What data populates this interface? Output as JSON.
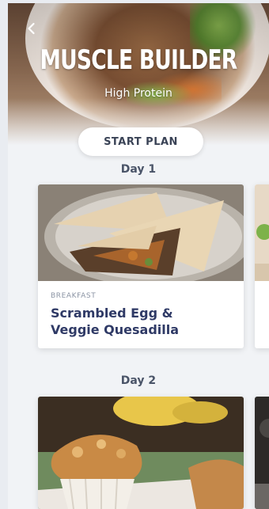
{
  "header": {
    "title": "MUSCLE BUILDER",
    "subtitle": "High Protein",
    "start_button_label": "START PLAN",
    "back_icon": "chevron-left-icon"
  },
  "days": [
    {
      "label": "Day 1",
      "meals": [
        {
          "type": "BREAKFAST",
          "name_line1": "Scrambled Egg &",
          "name_line2": "Veggie Quesadilla"
        }
      ]
    },
    {
      "label": "Day 2"
    }
  ],
  "colors": {
    "accent_text": "#2f3a66",
    "label_text": "#4a5468"
  }
}
